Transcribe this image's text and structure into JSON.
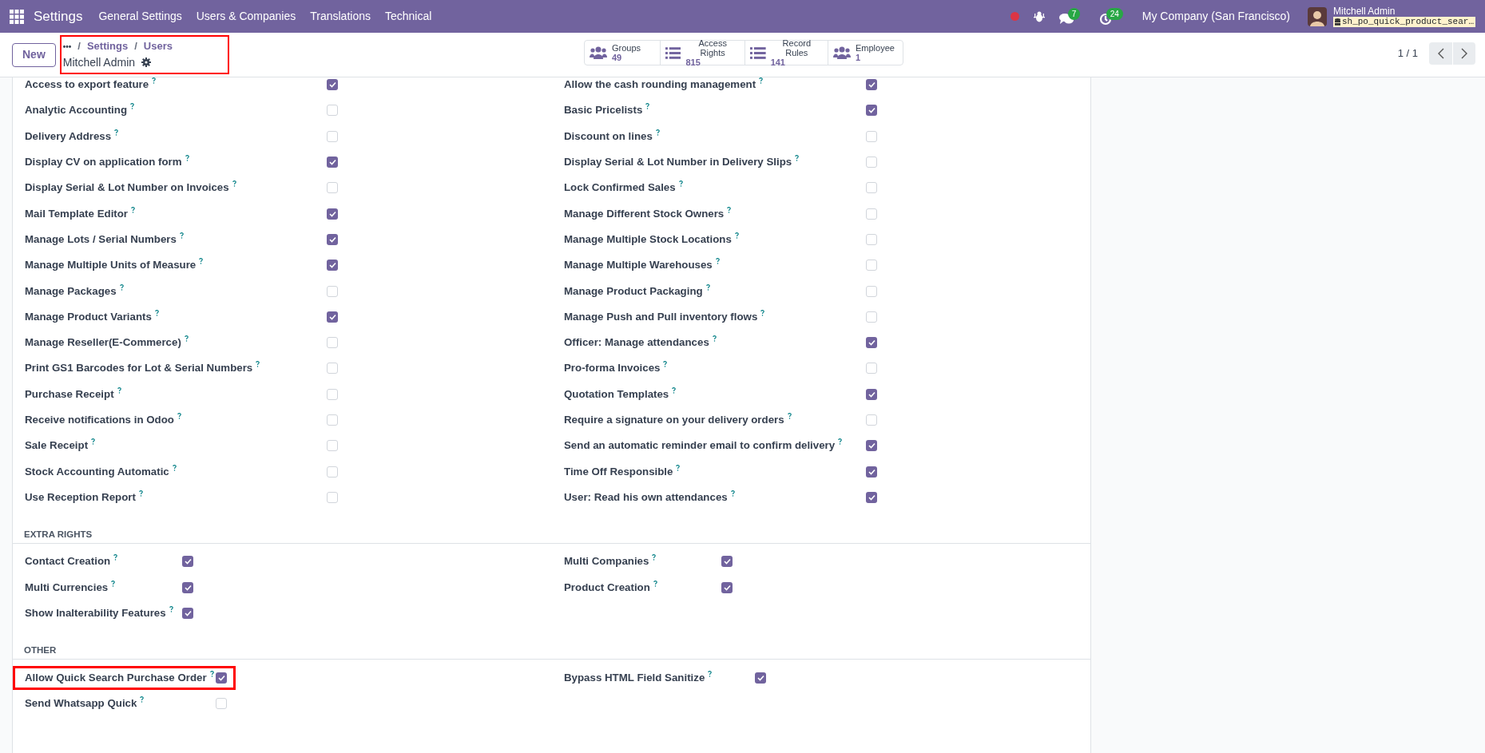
{
  "navbar": {
    "app": "Settings",
    "menu": [
      "General Settings",
      "Users & Companies",
      "Translations",
      "Technical"
    ],
    "messages_count": "7",
    "activities_count": "24",
    "company": "My Company (San Francisco)",
    "user": "Mitchell Admin",
    "database": "sh_po_quick_product_sear…"
  },
  "control_panel": {
    "new_button": "New",
    "breadcrumb": {
      "ellipsis": "•••",
      "separator": "/",
      "items": [
        "Settings",
        "Users"
      ],
      "highlighted": true
    },
    "record": "Mitchell Admin",
    "stat_buttons": [
      {
        "kind": "group",
        "label": "Groups",
        "value": "49"
      },
      {
        "kind": "list",
        "label": "Access Rights",
        "value": "815"
      },
      {
        "kind": "list",
        "label": "Record Rules",
        "value": "141"
      },
      {
        "kind": "group",
        "label": "Employee",
        "value": "1"
      }
    ],
    "pager": "1 / 1"
  },
  "sections": [
    {
      "columns": [
        [
          {
            "label": "Access to export feature",
            "checked": true
          },
          {
            "label": "Analytic Accounting",
            "checked": false
          },
          {
            "label": "Delivery Address",
            "checked": false
          },
          {
            "label": "Display CV on application form",
            "checked": true
          },
          {
            "label": "Display Serial & Lot Number on Invoices",
            "checked": false
          },
          {
            "label": "Mail Template Editor",
            "checked": true
          },
          {
            "label": "Manage Lots / Serial Numbers",
            "checked": true
          },
          {
            "label": "Manage Multiple Units of Measure",
            "checked": true
          },
          {
            "label": "Manage Packages",
            "checked": false
          },
          {
            "label": "Manage Product Variants",
            "checked": true
          },
          {
            "label": "Manage Reseller(E-Commerce)",
            "checked": false
          },
          {
            "label": "Print GS1 Barcodes for Lot & Serial Numbers",
            "checked": false
          },
          {
            "label": "Purchase Receipt",
            "checked": false
          },
          {
            "label": "Receive notifications in Odoo",
            "checked": false
          },
          {
            "label": "Sale Receipt",
            "checked": false
          },
          {
            "label": "Stock Accounting Automatic",
            "checked": false
          },
          {
            "label": "Use Reception Report",
            "checked": false
          }
        ],
        [
          {
            "label": "Allow the cash rounding management",
            "checked": true
          },
          {
            "label": "Basic Pricelists",
            "checked": true
          },
          {
            "label": "Discount on lines",
            "checked": false
          },
          {
            "label": "Display Serial & Lot Number in Delivery Slips",
            "checked": false
          },
          {
            "label": "Lock Confirmed Sales",
            "checked": false
          },
          {
            "label": "Manage Different Stock Owners",
            "checked": false
          },
          {
            "label": "Manage Multiple Stock Locations",
            "checked": false
          },
          {
            "label": "Manage Multiple Warehouses",
            "checked": false
          },
          {
            "label": "Manage Product Packaging",
            "checked": false
          },
          {
            "label": "Manage Push and Pull inventory flows",
            "checked": false
          },
          {
            "label": "Officer: Manage attendances",
            "checked": true
          },
          {
            "label": "Pro-forma Invoices",
            "checked": false
          },
          {
            "label": "Quotation Templates",
            "checked": true
          },
          {
            "label": "Require a signature on your delivery orders",
            "checked": false
          },
          {
            "label": "Send an automatic reminder email to confirm delivery",
            "checked": true
          },
          {
            "label": "Time Off Responsible",
            "checked": true
          },
          {
            "label": "User: Read his own attendances",
            "checked": true
          }
        ]
      ]
    },
    {
      "title": "EXTRA RIGHTS",
      "columns": [
        [
          {
            "label": "Contact Creation",
            "checked": true
          },
          {
            "label": "Multi Currencies",
            "checked": true
          },
          {
            "label": "Show Inalterability Features",
            "checked": true
          }
        ],
        [
          {
            "label": "Multi Companies",
            "checked": true
          },
          {
            "label": "Product Creation",
            "checked": true
          }
        ]
      ]
    },
    {
      "title": "OTHER",
      "columns": [
        [
          {
            "label": "Allow Quick Search Purchase Order",
            "checked": true,
            "highlighted": true
          },
          {
            "label": "Send Whatsapp Quick",
            "checked": false
          }
        ],
        [
          {
            "label": "Bypass HTML Field Sanitize",
            "checked": true
          }
        ]
      ]
    }
  ]
}
